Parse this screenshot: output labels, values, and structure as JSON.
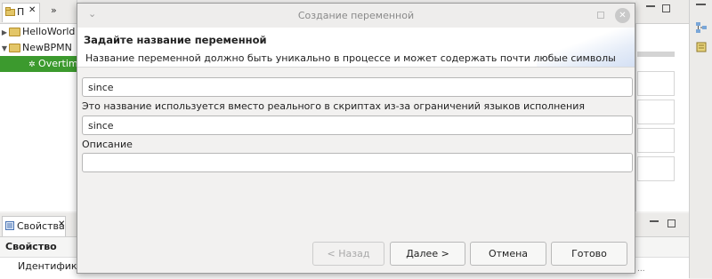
{
  "background": {
    "left_panel": {
      "tab_label": "П",
      "tree_items": [
        {
          "label": "HelloWorld",
          "expanded": false
        },
        {
          "label": "NewBPMN",
          "expanded": true
        },
        {
          "label": "Overtime",
          "selected": true
        }
      ]
    },
    "bottom_panel": {
      "tab_label": "Свойства",
      "column_header": "Свойство",
      "row_label": "Идентификат"
    }
  },
  "dialog": {
    "title": "Создание переменной",
    "heading": "Задайте название переменной",
    "description": "Название переменной должно быть уникально в процессе и может содержать почти любые символы",
    "name_value": "since",
    "script_name_label": "Это название используется вместо реального в скриптах из-за ограничений языков исполнения",
    "script_name_value": "since",
    "description_label": "Описание",
    "description_value": "",
    "buttons": {
      "back": "< Назад",
      "next": "Далее >",
      "cancel": "Отмена",
      "finish": "Готово"
    }
  },
  "colors": {
    "selection": "#3c9a2e",
    "dialog_bg": "#f2f1f0",
    "field_border": "#b7b7b7"
  }
}
